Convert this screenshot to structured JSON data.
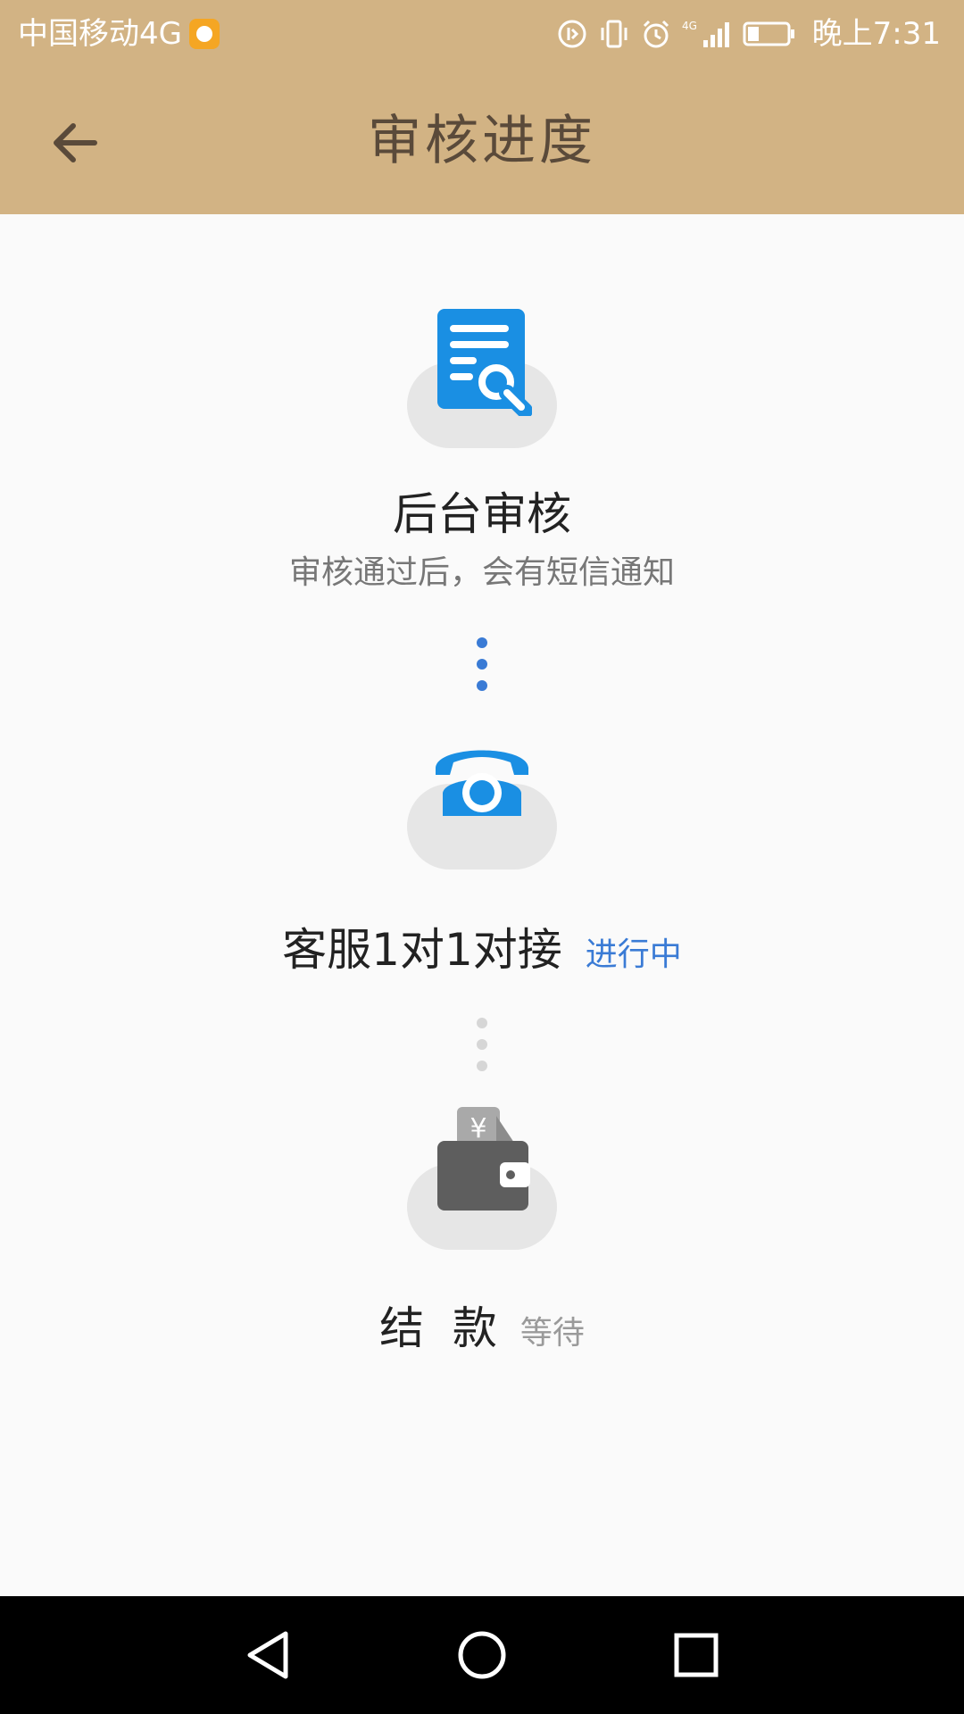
{
  "status_bar": {
    "carrier": "中国移动4G",
    "network": "4G",
    "time": "晚上7:31"
  },
  "app_bar": {
    "title": "审核进度"
  },
  "steps": [
    {
      "title": "后台审核",
      "subtitle": "审核通过后，会有短信通知",
      "icon": "document-search-icon"
    },
    {
      "title": "客服1对1对接",
      "status": "进行中",
      "icon": "telephone-icon"
    },
    {
      "title": "结  款",
      "status": "等待",
      "icon": "wallet-icon"
    }
  ],
  "colors": {
    "header": "#d2b384",
    "accent_blue": "#1a8fe3",
    "active_text": "#3a7bd5",
    "inactive_gray": "#5e5e5e"
  }
}
